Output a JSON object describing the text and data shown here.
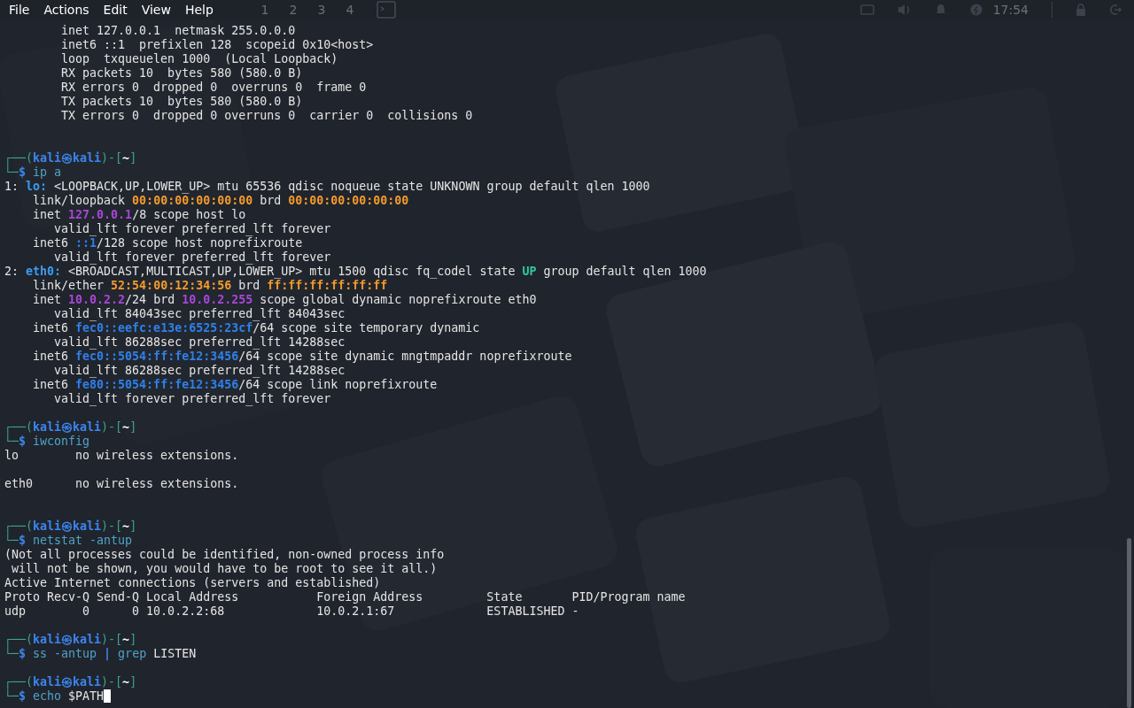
{
  "menu": [
    "File",
    "Actions",
    "Edit",
    "View",
    "Help"
  ],
  "panel": {
    "workspaces": [
      "1",
      "2",
      "3",
      "4"
    ],
    "clock": "17:54"
  },
  "terminal": {
    "lines": [
      {
        "kind": "text",
        "segments": [
          {
            "text": "        inet 127.0.0.1  netmask 255.0.0.0",
            "kind": "plain"
          }
        ]
      },
      {
        "kind": "text",
        "segments": [
          {
            "text": "        inet6 ::1  prefixlen 128  scopeid 0x10<host>",
            "kind": "plain"
          }
        ]
      },
      {
        "kind": "text",
        "segments": [
          {
            "text": "        loop  txqueuelen 1000  (Local Loopback)",
            "kind": "plain"
          }
        ]
      },
      {
        "kind": "text",
        "segments": [
          {
            "text": "        RX packets 10  bytes 580 (580.0 B)",
            "kind": "plain"
          }
        ]
      },
      {
        "kind": "text",
        "segments": [
          {
            "text": "        RX errors 0  dropped 0  overruns 0  frame 0",
            "kind": "plain"
          }
        ]
      },
      {
        "kind": "text",
        "segments": [
          {
            "text": "        TX packets 10  bytes 580 (580.0 B)",
            "kind": "plain"
          }
        ]
      },
      {
        "kind": "text",
        "segments": [
          {
            "text": "        TX errors 0  dropped 0 overruns 0  carrier 0  collisions 0",
            "kind": "plain"
          }
        ]
      },
      {
        "kind": "blank"
      },
      {
        "kind": "blank"
      },
      {
        "kind": "text",
        "segments": [
          {
            "text": "┌──(",
            "kind": "frame"
          },
          {
            "text": "kali㉿kali",
            "kind": "user"
          },
          {
            "text": ")-[",
            "kind": "frame"
          },
          {
            "text": "~",
            "kind": "path"
          },
          {
            "text": "]",
            "kind": "frame"
          }
        ]
      },
      {
        "kind": "text",
        "segments": [
          {
            "text": "└─",
            "kind": "frame"
          },
          {
            "text": "$ ",
            "kind": "dollar"
          },
          {
            "text": "ip a",
            "kind": "cmd"
          }
        ]
      },
      {
        "kind": "text",
        "segments": [
          {
            "text": "1: ",
            "kind": "plain"
          },
          {
            "text": "lo:",
            "kind": "iface"
          },
          {
            "text": " <LOOPBACK,UP,LOWER_UP> mtu 65536 qdisc noqueue state UNKNOWN group default qlen 1000",
            "kind": "plain"
          }
        ]
      },
      {
        "kind": "text",
        "segments": [
          {
            "text": "    link/loopback ",
            "kind": "plain"
          },
          {
            "text": "00:00:00:00:00:00",
            "kind": "mac"
          },
          {
            "text": " brd ",
            "kind": "plain"
          },
          {
            "text": "00:00:00:00:00:00",
            "kind": "mac"
          }
        ]
      },
      {
        "kind": "text",
        "segments": [
          {
            "text": "    inet ",
            "kind": "plain"
          },
          {
            "text": "127.0.0.1",
            "kind": "ipv4"
          },
          {
            "text": "/8 scope host lo",
            "kind": "plain"
          }
        ]
      },
      {
        "kind": "text",
        "segments": [
          {
            "text": "       valid_lft forever preferred_lft forever",
            "kind": "plain"
          }
        ]
      },
      {
        "kind": "text",
        "segments": [
          {
            "text": "    inet6 ",
            "kind": "plain"
          },
          {
            "text": "::1",
            "kind": "ipv6"
          },
          {
            "text": "/128 scope host noprefixroute",
            "kind": "plain"
          }
        ]
      },
      {
        "kind": "text",
        "segments": [
          {
            "text": "       valid_lft forever preferred_lft forever",
            "kind": "plain"
          }
        ]
      },
      {
        "kind": "text",
        "segments": [
          {
            "text": "2: ",
            "kind": "plain"
          },
          {
            "text": "eth0:",
            "kind": "iface"
          },
          {
            "text": " <BROADCAST,MULTICAST,UP,LOWER_UP> mtu 1500 qdisc fq_codel state ",
            "kind": "plain"
          },
          {
            "text": "UP",
            "kind": "up"
          },
          {
            "text": " group default qlen 1000",
            "kind": "plain"
          }
        ]
      },
      {
        "kind": "text",
        "segments": [
          {
            "text": "    link/ether ",
            "kind": "plain"
          },
          {
            "text": "52:54:00:12:34:56",
            "kind": "mac"
          },
          {
            "text": " brd ",
            "kind": "plain"
          },
          {
            "text": "ff:ff:ff:ff:ff:ff",
            "kind": "mac"
          }
        ]
      },
      {
        "kind": "text",
        "segments": [
          {
            "text": "    inet ",
            "kind": "plain"
          },
          {
            "text": "10.0.2.2",
            "kind": "ipv4"
          },
          {
            "text": "/24 brd ",
            "kind": "plain"
          },
          {
            "text": "10.0.2.255",
            "kind": "ipv4"
          },
          {
            "text": " scope global dynamic noprefixroute eth0",
            "kind": "plain"
          }
        ]
      },
      {
        "kind": "text",
        "segments": [
          {
            "text": "       valid_lft 84043sec preferred_lft 84043sec",
            "kind": "plain"
          }
        ]
      },
      {
        "kind": "text",
        "segments": [
          {
            "text": "    inet6 ",
            "kind": "plain"
          },
          {
            "text": "fec0::eefc:e13e:6525:23cf",
            "kind": "ipv6"
          },
          {
            "text": "/64 scope site temporary dynamic",
            "kind": "plain"
          }
        ]
      },
      {
        "kind": "text",
        "segments": [
          {
            "text": "       valid_lft 86288sec preferred_lft 14288sec",
            "kind": "plain"
          }
        ]
      },
      {
        "kind": "text",
        "segments": [
          {
            "text": "    inet6 ",
            "kind": "plain"
          },
          {
            "text": "fec0::5054:ff:fe12:3456",
            "kind": "ipv6"
          },
          {
            "text": "/64 scope site dynamic mngtmpaddr noprefixroute",
            "kind": "plain"
          }
        ]
      },
      {
        "kind": "text",
        "segments": [
          {
            "text": "       valid_lft 86288sec preferred_lft 14288sec",
            "kind": "plain"
          }
        ]
      },
      {
        "kind": "text",
        "segments": [
          {
            "text": "    inet6 ",
            "kind": "plain"
          },
          {
            "text": "fe80::5054:ff:fe12:3456",
            "kind": "ipv6"
          },
          {
            "text": "/64 scope link noprefixroute",
            "kind": "plain"
          }
        ]
      },
      {
        "kind": "text",
        "segments": [
          {
            "text": "       valid_lft forever preferred_lft forever",
            "kind": "plain"
          }
        ]
      },
      {
        "kind": "blank"
      },
      {
        "kind": "text",
        "segments": [
          {
            "text": "┌──(",
            "kind": "frame"
          },
          {
            "text": "kali㉿kali",
            "kind": "user"
          },
          {
            "text": ")-[",
            "kind": "frame"
          },
          {
            "text": "~",
            "kind": "path"
          },
          {
            "text": "]",
            "kind": "frame"
          }
        ]
      },
      {
        "kind": "text",
        "segments": [
          {
            "text": "└─",
            "kind": "frame"
          },
          {
            "text": "$ ",
            "kind": "dollar"
          },
          {
            "text": "iwconfig",
            "kind": "cmd"
          }
        ]
      },
      {
        "kind": "text",
        "segments": [
          {
            "text": "lo        no wireless extensions.",
            "kind": "plain"
          }
        ]
      },
      {
        "kind": "blank"
      },
      {
        "kind": "text",
        "segments": [
          {
            "text": "eth0      no wireless extensions.",
            "kind": "plain"
          }
        ]
      },
      {
        "kind": "blank"
      },
      {
        "kind": "blank"
      },
      {
        "kind": "text",
        "segments": [
          {
            "text": "┌──(",
            "kind": "frame"
          },
          {
            "text": "kali㉿kali",
            "kind": "user"
          },
          {
            "text": ")-[",
            "kind": "frame"
          },
          {
            "text": "~",
            "kind": "path"
          },
          {
            "text": "]",
            "kind": "frame"
          }
        ]
      },
      {
        "kind": "text",
        "segments": [
          {
            "text": "└─",
            "kind": "frame"
          },
          {
            "text": "$ ",
            "kind": "dollar"
          },
          {
            "text": "netstat -antup",
            "kind": "cmd"
          }
        ]
      },
      {
        "kind": "text",
        "segments": [
          {
            "text": "(Not all processes could be identified, non-owned process info",
            "kind": "plain"
          }
        ]
      },
      {
        "kind": "text",
        "segments": [
          {
            "text": " will not be shown, you would have to be root to see it all.)",
            "kind": "plain"
          }
        ]
      },
      {
        "kind": "text",
        "segments": [
          {
            "text": "Active Internet connections (servers and established)",
            "kind": "plain"
          }
        ]
      },
      {
        "kind": "text",
        "segments": [
          {
            "text": "Proto Recv-Q Send-Q Local Address           Foreign Address         State       PID/Program name",
            "kind": "plain"
          }
        ]
      },
      {
        "kind": "text",
        "segments": [
          {
            "text": "udp        0      0 10.0.2.2:68             10.0.2.1:67             ESTABLISHED -",
            "kind": "plain"
          }
        ]
      },
      {
        "kind": "blank"
      },
      {
        "kind": "text",
        "segments": [
          {
            "text": "┌──(",
            "kind": "frame"
          },
          {
            "text": "kali㉿kali",
            "kind": "user"
          },
          {
            "text": ")-[",
            "kind": "frame"
          },
          {
            "text": "~",
            "kind": "path"
          },
          {
            "text": "]",
            "kind": "frame"
          }
        ]
      },
      {
        "kind": "text",
        "segments": [
          {
            "text": "└─",
            "kind": "frame"
          },
          {
            "text": "$ ",
            "kind": "dollar"
          },
          {
            "text": "ss -antup ",
            "kind": "cmd"
          },
          {
            "text": "|",
            "kind": "pipe"
          },
          {
            "text": " grep ",
            "kind": "cmd"
          },
          {
            "text": "LISTEN",
            "kind": "plain"
          }
        ]
      },
      {
        "kind": "blank"
      },
      {
        "kind": "text",
        "segments": [
          {
            "text": "┌──(",
            "kind": "frame"
          },
          {
            "text": "kali㉿kali",
            "kind": "user"
          },
          {
            "text": ")-[",
            "kind": "frame"
          },
          {
            "text": "~",
            "kind": "path"
          },
          {
            "text": "]",
            "kind": "frame"
          }
        ]
      },
      {
        "kind": "text",
        "segments": [
          {
            "text": "└─",
            "kind": "frame"
          },
          {
            "text": "$ ",
            "kind": "dollar"
          },
          {
            "text": "echo ",
            "kind": "cmd"
          },
          {
            "text": "$PATH",
            "kind": "plain"
          }
        ]
      }
    ],
    "cursor": true
  }
}
